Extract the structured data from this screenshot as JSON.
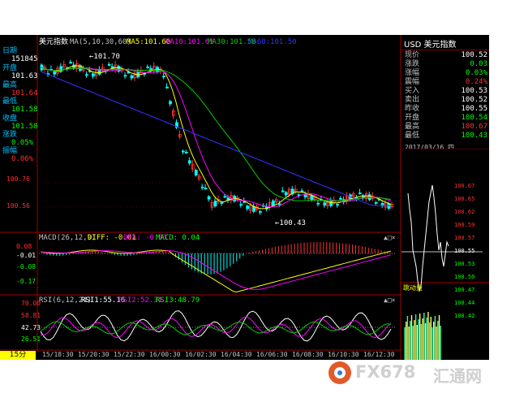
{
  "header": {
    "title": "美元指数",
    "ma_prefix": "MA(5,10,30,60)",
    "ma5": "MA5:101.60",
    "ma10": "MA10:101.65",
    "ma30": "MA30:101.58",
    "ma60": "MA60:101.50"
  },
  "left_info": {
    "date_label": "日期",
    "date_value": "151845",
    "open_label": "开盘",
    "open_value": "101.63",
    "high_label": "最高",
    "high_value": "101.64",
    "low_label": "最低",
    "low_value": "101.58",
    "close_label": "收盘",
    "close_value": "101.58",
    "change_label": "涨跌",
    "change_value": "0.05%",
    "amp_label": "振幅",
    "amp_value": "0.06%"
  },
  "price_axis": {
    "ticks": [
      "100.76",
      "100.56"
    ]
  },
  "annotations": {
    "high": "101.70",
    "low": "100.43"
  },
  "macd": {
    "label": "MACD(26,12,9)",
    "diff": "DIFF: -0.01",
    "dea": "DEA: -0.03",
    "macd": "MACD: 0.04",
    "ticks": [
      "0.08",
      "-0.01",
      "-0.08",
      "-0.17"
    ]
  },
  "rsi": {
    "label": "RSI(6,12,24)",
    "rsi1": "RSI1:55.16",
    "rsi2": "RSI2:52.31",
    "rsi3": "RSI3:48.79",
    "ticks": [
      "70.00",
      "58.81",
      "42.73",
      "26.51"
    ]
  },
  "window_controls": [
    "▲",
    "□",
    "×"
  ],
  "period": "15分",
  "time_axis": [
    "15/18:30",
    "15/20:30",
    "15/22:30",
    "16/00:30",
    "16/02:30",
    "16/04:30",
    "16/06:30",
    "16/08:30",
    "16/10:30",
    "16/12:30"
  ],
  "quote_panel": {
    "title": "USD 美元指数",
    "rows": [
      {
        "k": "现价",
        "v": "100.52",
        "c": "#ffffff"
      },
      {
        "k": "涨跌",
        "v": "0.03",
        "c": "#00ff00"
      },
      {
        "k": "涨幅",
        "v": "0.03%",
        "c": "#00ff00"
      },
      {
        "k": "震幅",
        "v": "0.24%",
        "c": "#ff3030"
      },
      {
        "k": "买入",
        "v": "100.53",
        "c": "#ffffff"
      },
      {
        "k": "卖出",
        "v": "100.52",
        "c": "#ffffff"
      },
      {
        "k": "昨收",
        "v": "100.55",
        "c": "#ffffff"
      },
      {
        "k": "开盘",
        "v": "100.54",
        "c": "#00ff00"
      },
      {
        "k": "最高",
        "v": "100.67",
        "c": "#ff3030"
      },
      {
        "k": "最低",
        "v": "100.43",
        "c": "#00ff00"
      }
    ]
  },
  "intraday": {
    "date": "2017/03/16",
    "weekday": "四",
    "ticks": [
      "100.67",
      "100.65",
      "100.62",
      "100.59",
      "100.57",
      "100.55",
      "100.53",
      "100.50",
      "100.47",
      "100.44",
      "100.42"
    ],
    "volume_label": "跳动量"
  },
  "watermark": {
    "brand": "FX678",
    "cn": "汇通网"
  },
  "colors": {
    "background": "#000000",
    "up_candle": "#ff3333",
    "down_candle": "#00ffff",
    "ma5": "#ffff00",
    "ma10": "#ff00ff",
    "ma30": "#00cc00",
    "ma60": "#3333ff"
  }
}
